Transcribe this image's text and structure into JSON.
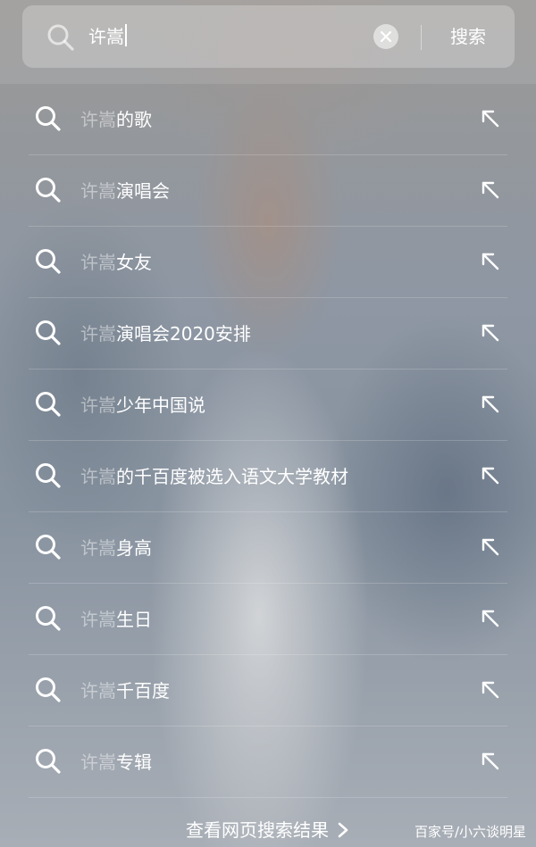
{
  "search": {
    "query": "许嵩",
    "submit_label": "搜索"
  },
  "suggestions": [
    {
      "query_part": "许嵩",
      "rest": "的歌"
    },
    {
      "query_part": "许嵩",
      "rest": "演唱会"
    },
    {
      "query_part": "许嵩",
      "rest": "女友"
    },
    {
      "query_part": "许嵩",
      "rest": "演唱会2020安排"
    },
    {
      "query_part": "许嵩",
      "rest": "少年中国说"
    },
    {
      "query_part": "许嵩",
      "rest": "的千百度被选入语文大学教材"
    },
    {
      "query_part": "许嵩",
      "rest": "身高"
    },
    {
      "query_part": "许嵩",
      "rest": "生日"
    },
    {
      "query_part": "许嵩",
      "rest": "千百度"
    },
    {
      "query_part": "许嵩",
      "rest": "专辑"
    }
  ],
  "footer": {
    "web_results_label": "查看网页搜索结果"
  },
  "watermark": "百家号/小六谈明星",
  "icons": {
    "search": "search-icon",
    "clear": "clear-icon",
    "fill": "arrow-up-left-icon",
    "more": "chevron-right-icon"
  },
  "colors": {
    "text": "#ffffff",
    "query_highlight": "#ffffff73"
  }
}
